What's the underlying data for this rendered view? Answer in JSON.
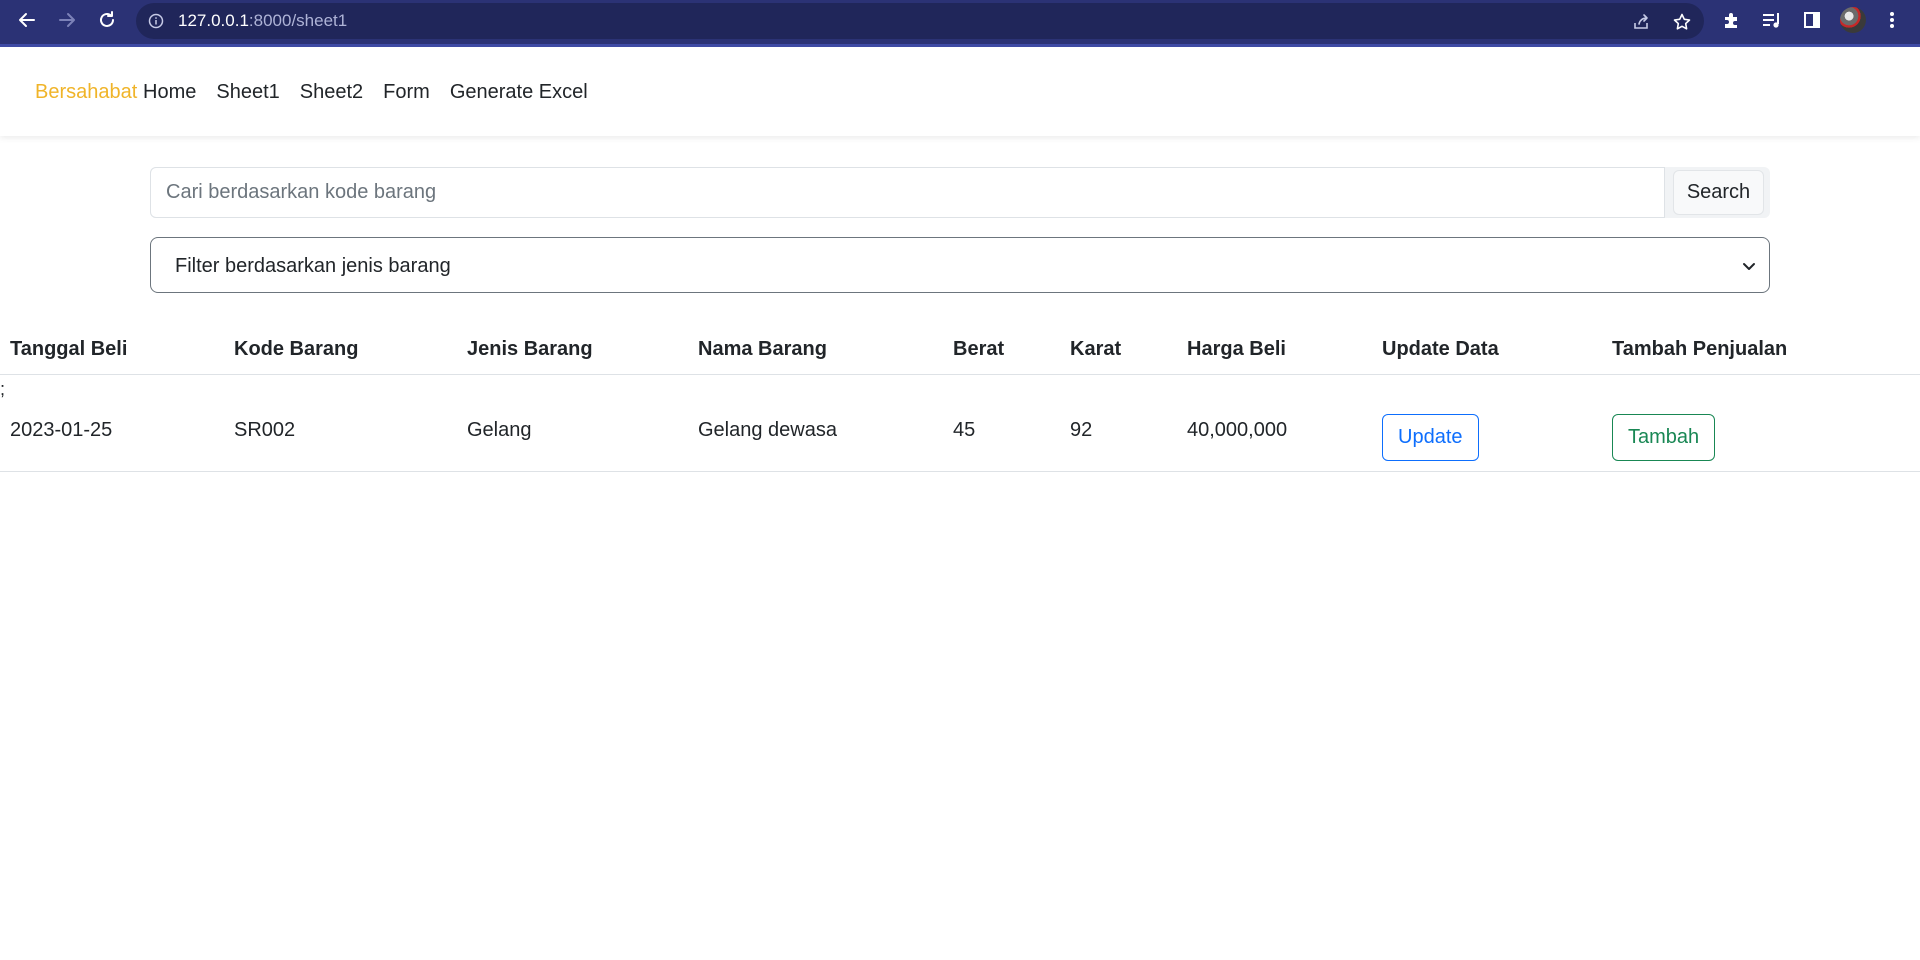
{
  "browser": {
    "url_host": "127.0.0.1",
    "url_path": ":8000/sheet1",
    "toolbar_icons": [
      "back-icon",
      "forward-icon",
      "reload-icon",
      "info-icon",
      "share-icon",
      "star-icon",
      "puzzle-icon",
      "media-icon",
      "sidepanel-icon",
      "menu-icon"
    ]
  },
  "navbar": {
    "brand": "Bersahabat",
    "links": [
      "Home",
      "Sheet1",
      "Sheet2",
      "Form",
      "Generate Excel"
    ],
    "brand_color": "#f0b429"
  },
  "search": {
    "placeholder": "Cari berdasarkan kode barang",
    "button_label": "Search"
  },
  "filter": {
    "selected": "Filter berdasarkan jenis barang"
  },
  "table": {
    "headers": [
      "Tanggal Beli",
      "Kode Barang",
      "Jenis Barang",
      "Nama Barang",
      "Berat",
      "Karat",
      "Harga Beli",
      "Update Data",
      "Tambah Penjualan"
    ],
    "stray_text": ";",
    "rows": [
      {
        "tanggal_beli": "2023-01-25",
        "kode_barang": "SR002",
        "jenis_barang": "Gelang",
        "nama_barang": "Gelang dewasa",
        "berat": "45",
        "karat": "92",
        "harga_beli": "40,000,000",
        "update_label": "Update",
        "tambah_label": "Tambah"
      }
    ]
  },
  "colors": {
    "chrome": "#2b3275",
    "primary": "#0d6efd",
    "success": "#198754"
  }
}
